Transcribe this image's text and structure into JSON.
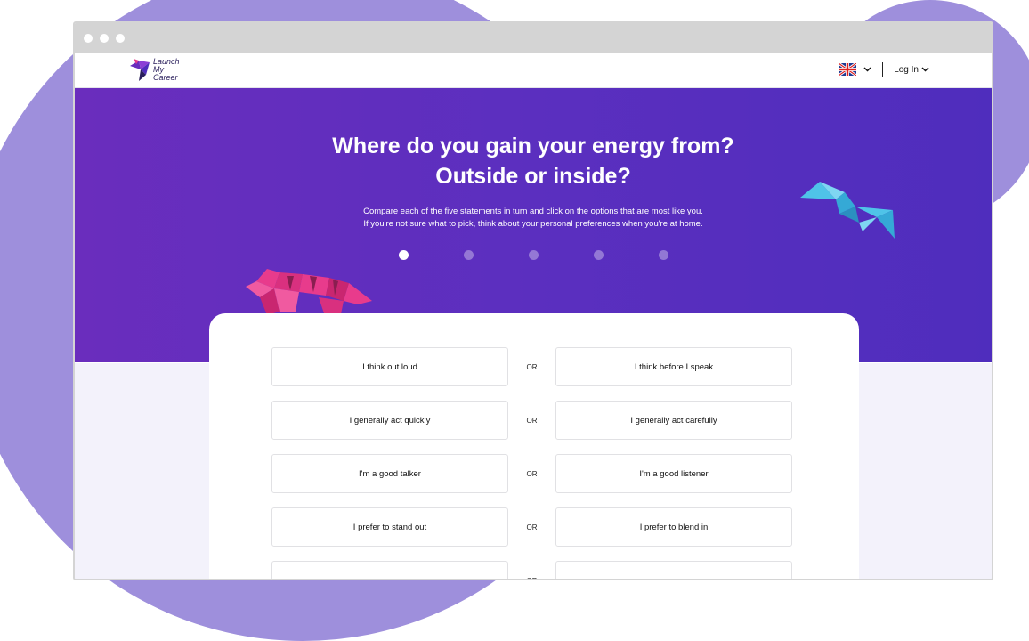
{
  "logo": {
    "line1": "Launch My",
    "line2": "Career"
  },
  "header": {
    "language_icon": "uk-flag-icon",
    "login_label": "Log In"
  },
  "hero": {
    "title_line1": "Where do you gain your energy from?",
    "title_line2": "Outside or inside?",
    "intro_line1": "Compare each of the five statements in turn and click on the options that are most like you.",
    "intro_line2": "If you're not sure what to pick, think about your personal preferences when you're at home."
  },
  "progress": {
    "total_steps": 5,
    "current_step": 1
  },
  "statements": [
    {
      "left": "I think out loud",
      "or": "OR",
      "right": "I think before I speak"
    },
    {
      "left": "I generally act quickly",
      "or": "OR",
      "right": "I generally act carefully"
    },
    {
      "left": "I'm a good talker",
      "or": "OR",
      "right": "I'm a good listener"
    },
    {
      "left": "I prefer to stand out",
      "or": "OR",
      "right": "I prefer to blend in"
    },
    {
      "left": "",
      "or": "OR",
      "right": ""
    }
  ],
  "colors": {
    "hero_start": "#6a2dbd",
    "hero_end": "#4f2dbd",
    "accent_blob": "#9e8fdc",
    "tiger": "#e83b8c",
    "bird": "#4fc3e8"
  }
}
